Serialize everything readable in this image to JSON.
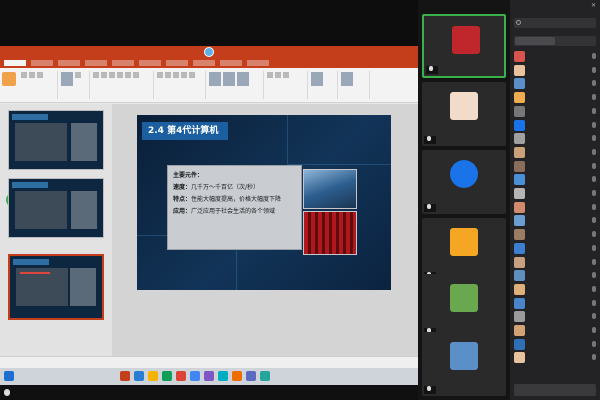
{
  "ppt": {
    "window_title": "",
    "signin_text": "",
    "window_controls": "",
    "tabs": [
      "",
      "",
      "",
      "",
      "",
      "",
      "",
      "",
      "",
      ""
    ],
    "ribbon_groups": [
      "",
      "",
      "",
      "",
      "",
      "",
      "",
      ""
    ],
    "status": {
      "slide_counter": "",
      "zoom": ""
    },
    "notes_placeholder": ""
  },
  "thumbnails": {
    "numbers": [
      "",
      "",
      ""
    ],
    "selected_index": 2
  },
  "slide": {
    "heading": "2.4 第4代计算机",
    "lines": [
      {
        "label": "",
        "value": "",
        "red": true
      },
      {
        "label": "主要元件：",
        "value": "",
        "red_value": true
      },
      {
        "label": "速度：",
        "value": "几千万～千百亿（次/秒）"
      },
      {
        "label": "特点：",
        "value": "性能大幅度提高，价格大幅度下降"
      },
      {
        "label": "应用：",
        "value": "广泛应用于社会生活的各个领域"
      }
    ]
  },
  "taskbar": {
    "clock": ""
  },
  "shared_screen_label": "",
  "videos": [
    {
      "name": "",
      "avatar_color": "#c0272d",
      "active": true
    },
    {
      "name": "",
      "avatar_color": "#f2dcc9",
      "active": false
    },
    {
      "name": "",
      "avatar_color": "#1a73e8",
      "active": false,
      "avatar_text": ""
    },
    {
      "name": "",
      "avatar_color": "#f5a623",
      "active": false,
      "avatar_text": ""
    },
    {
      "name": "",
      "avatar_color": "#6aa84f",
      "active": false
    },
    {
      "name": "",
      "avatar_color": "#5b8fc7",
      "active": false
    }
  ],
  "panel": {
    "title": "",
    "close_glyph": "✕",
    "search_placeholder": "",
    "tabs": [
      "",
      ""
    ],
    "participants": [
      {
        "name": "",
        "color": "#d9534f"
      },
      {
        "name": "",
        "color": "#e8c39e"
      },
      {
        "name": "",
        "color": "#5b8fc7"
      },
      {
        "name": "",
        "color": "#f0ad4e"
      },
      {
        "name": "",
        "color": "#777777"
      },
      {
        "name": "",
        "color": "#1a73e8"
      },
      {
        "name": "",
        "color": "#a0a0a0"
      },
      {
        "name": "",
        "color": "#c9a27a"
      },
      {
        "name": "",
        "color": "#8a6d5a"
      },
      {
        "name": "",
        "color": "#4a90d9"
      },
      {
        "name": "",
        "color": "#b5b5b5"
      },
      {
        "name": "",
        "color": "#d08b6e"
      },
      {
        "name": "",
        "color": "#6a9fd4"
      },
      {
        "name": "",
        "color": "#9c7b63"
      },
      {
        "name": "",
        "color": "#3c7fd0"
      },
      {
        "name": "",
        "color": "#c7a17f"
      },
      {
        "name": "",
        "color": "#5f8fbf"
      },
      {
        "name": "",
        "color": "#e0b07a"
      },
      {
        "name": "",
        "color": "#4a84c9"
      },
      {
        "name": "",
        "color": "#9b9b9b"
      },
      {
        "name": "",
        "color": "#d4a373"
      },
      {
        "name": "",
        "color": "#2f6fb8"
      },
      {
        "name": "",
        "color": "#e8c39e"
      }
    ],
    "footer_button": ""
  },
  "watermark": ""
}
